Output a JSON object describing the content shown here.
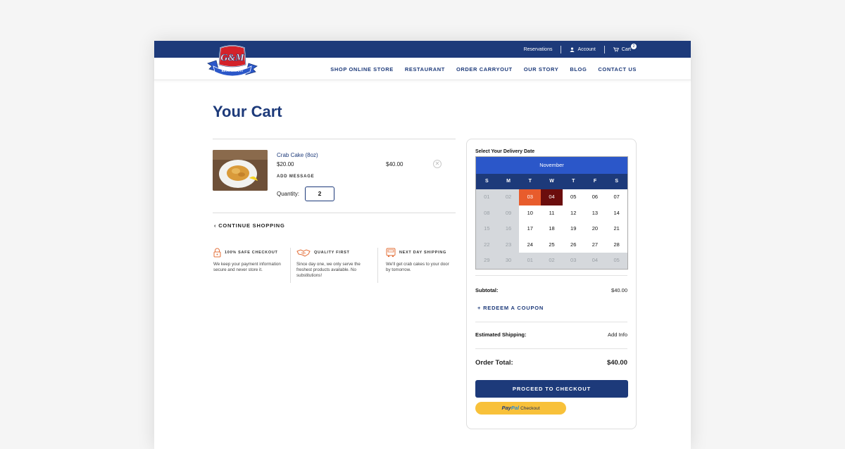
{
  "header": {
    "logo_text": "G&M",
    "logo_subtext": "RESTAURANT",
    "utility_links": [
      {
        "label": "Reservations",
        "icon": ""
      },
      {
        "label": "Account",
        "icon": "user-icon"
      },
      {
        "label": "Cart",
        "icon": "cart-icon",
        "badge": "2"
      }
    ],
    "nav": [
      "SHOP ONLINE STORE",
      "RESTAURANT",
      "ORDER CARRYOUT",
      "OUR STORY",
      "BLOG",
      "CONTACT US"
    ]
  },
  "page": {
    "title": "Your Cart"
  },
  "cart_item": {
    "name": "Crab Cake (8oz)",
    "unit_price": "$20.00",
    "add_message": "ADD MESSAGE",
    "quantity_label": "Quantity:",
    "quantity": "2",
    "line_total": "$40.00",
    "remove_icon": "close-circle-icon"
  },
  "continue_shopping": "CONTINUE SHOPPING",
  "features": [
    {
      "icon": "lock-icon",
      "title": "100% SAFE CHECKOUT",
      "text": "We keep your payment information secure and never store it."
    },
    {
      "icon": "handshake-icon",
      "title": "QUALITY FIRST",
      "text": "Since day one, we only serve the freshest products available. No substitutions!"
    },
    {
      "icon": "truck-icon",
      "title": "NEXT DAY SHIPPING",
      "text": "We'll get crab cakes to your door by tomorrow."
    }
  ],
  "summary": {
    "delivery_heading": "Select Your Delivery Date",
    "calendar": {
      "month": "November",
      "weekdays": [
        "S",
        "M",
        "T",
        "W",
        "T",
        "F",
        "S"
      ],
      "weeks": [
        [
          {
            "d": "01",
            "s": "past"
          },
          {
            "d": "02",
            "s": "past"
          },
          {
            "d": "03",
            "s": "today"
          },
          {
            "d": "04",
            "s": "sel"
          },
          {
            "d": "05",
            "s": ""
          },
          {
            "d": "06",
            "s": ""
          },
          {
            "d": "07",
            "s": ""
          }
        ],
        [
          {
            "d": "08",
            "s": "past"
          },
          {
            "d": "09",
            "s": "past"
          },
          {
            "d": "10",
            "s": ""
          },
          {
            "d": "11",
            "s": ""
          },
          {
            "d": "12",
            "s": ""
          },
          {
            "d": "13",
            "s": ""
          },
          {
            "d": "14",
            "s": ""
          }
        ],
        [
          {
            "d": "15",
            "s": "past"
          },
          {
            "d": "16",
            "s": "past"
          },
          {
            "d": "17",
            "s": ""
          },
          {
            "d": "18",
            "s": ""
          },
          {
            "d": "19",
            "s": ""
          },
          {
            "d": "20",
            "s": ""
          },
          {
            "d": "21",
            "s": ""
          }
        ],
        [
          {
            "d": "22",
            "s": "past"
          },
          {
            "d": "23",
            "s": "past"
          },
          {
            "d": "24",
            "s": ""
          },
          {
            "d": "25",
            "s": ""
          },
          {
            "d": "26",
            "s": ""
          },
          {
            "d": "27",
            "s": ""
          },
          {
            "d": "28",
            "s": ""
          }
        ],
        [
          {
            "d": "29",
            "s": "past"
          },
          {
            "d": "30",
            "s": "past"
          },
          {
            "d": "01",
            "s": "next"
          },
          {
            "d": "02",
            "s": "next"
          },
          {
            "d": "03",
            "s": "next"
          },
          {
            "d": "04",
            "s": "next"
          },
          {
            "d": "05",
            "s": "next"
          }
        ]
      ]
    },
    "subtotal_label": "Subtotal:",
    "subtotal": "$40.00",
    "coupon": "+ REDEEM A COUPON",
    "shipping_label": "Estimated Shipping:",
    "shipping_value": "Add Info",
    "total_label": "Order Total:",
    "total": "$40.00",
    "checkout_button": "PROCEED TO CHECKOUT",
    "paypal": {
      "pay": "Pay",
      "pal": "Pal",
      "checkout": "Checkout"
    }
  }
}
